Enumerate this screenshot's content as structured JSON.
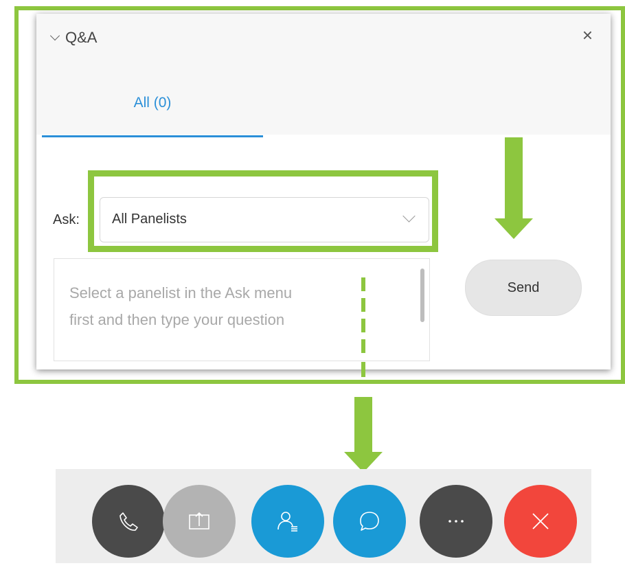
{
  "qa_panel": {
    "title": "Q&A",
    "close_glyph": "×",
    "tabs": [
      {
        "label": "All (0)",
        "active": true
      }
    ],
    "ask_label": "Ask:",
    "ask_select": {
      "value": "All Panelists"
    },
    "question_input": {
      "placeholder": "Select a panelist in the Ask menu\nfirst and then type your question"
    },
    "send_label": "Send"
  },
  "toolbar": {
    "buttons": [
      {
        "name": "audio",
        "icon": "phone-icon",
        "color": "#4a4a4a"
      },
      {
        "name": "share",
        "icon": "share-icon",
        "color": "#b3b3b3"
      },
      {
        "name": "participants",
        "icon": "participants-icon",
        "color": "#1a9ad6"
      },
      {
        "name": "chat",
        "icon": "chat-icon",
        "color": "#1a9ad6"
      },
      {
        "name": "more",
        "icon": "more-icon",
        "color": "#4a4a4a"
      },
      {
        "name": "leave",
        "icon": "close-icon",
        "color": "#f2463c"
      }
    ]
  },
  "colors": {
    "highlight": "#8dc63f",
    "accent": "#2a8fd8",
    "leave": "#f2463c"
  }
}
